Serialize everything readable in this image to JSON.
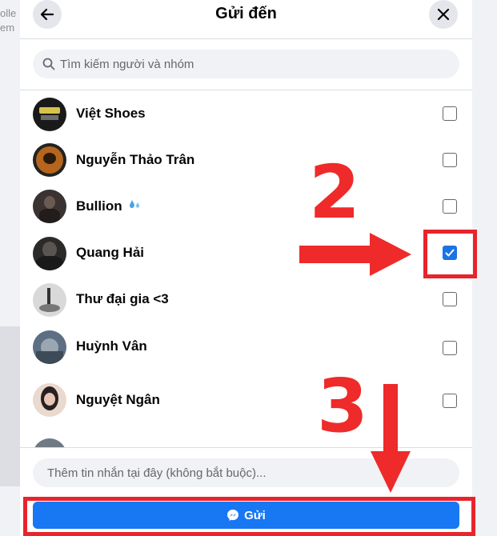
{
  "background": {
    "left_text_lines": [
      "olle",
      "em"
    ]
  },
  "dialog": {
    "title": "Gửi đến",
    "back_icon": "arrow-left-icon",
    "close_icon": "close-icon"
  },
  "search": {
    "placeholder": "Tìm kiếm người và nhóm",
    "icon": "search-icon"
  },
  "contacts": [
    {
      "name": "Việt Shoes",
      "checked": false
    },
    {
      "name": "Nguyễn Thảo Trân",
      "checked": false
    },
    {
      "name": "Bullion",
      "checked": false,
      "emoji": "sweat-droplets-icon"
    },
    {
      "name": "Quang Hải",
      "checked": true
    },
    {
      "name": "Thư đại gia <3",
      "checked": false
    },
    {
      "name": "Huỳnh Vân",
      "checked": false
    },
    {
      "name": "Nguyệt Ngân",
      "checked": false
    },
    {
      "name": "",
      "checked": false
    }
  ],
  "message": {
    "placeholder": "Thêm tin nhắn tại đây (không bắt buộc)..."
  },
  "send_button": {
    "label": "Gửi",
    "icon": "messenger-icon"
  },
  "annotations": {
    "step_2": "2",
    "step_3": "3"
  },
  "colors": {
    "accent": "#1877f2",
    "annotation_red": "#e8242c"
  }
}
